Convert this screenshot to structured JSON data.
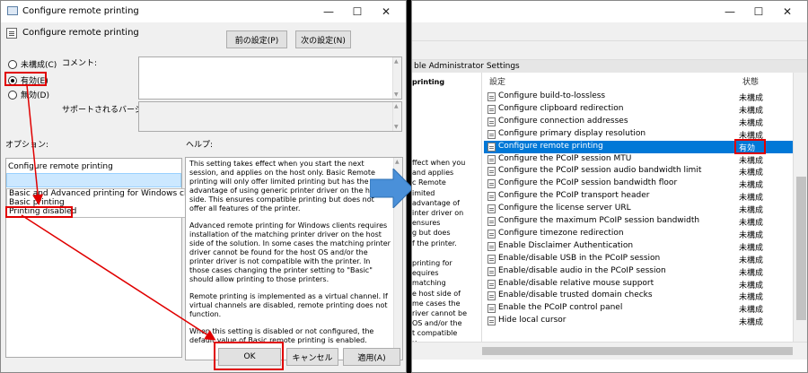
{
  "dialog": {
    "title": "Configure remote printing",
    "header_title": "Configure remote printing",
    "prev_button": "前の設定(P)",
    "next_button": "次の設定(N)",
    "radio_not_configured": "未構成(C)",
    "radio_enabled": "有効(E)",
    "radio_disabled": "無効(D)",
    "comment_label": "コメント:",
    "supported_label": "サポートされるバージョン:",
    "options_label": "オプション:",
    "help_label": "ヘルプ:",
    "combo_value": "Configure remote printing",
    "dropdown_options": [
      "Basic and Advanced printing for Windows clients",
      "Basic printing",
      "Printing disabled"
    ],
    "help_paragraphs": [
      "This setting takes effect when you start the next session, and applies on the host only. Basic Remote printing will only offer limited printing but has the advantage of using generic printer driver on the host side. This ensures compatible printing but does not offer all features of the printer.",
      "Advanced remote printing for Windows clients requires installation of the matching printer driver on the host side of the solution. In some cases the matching printer driver cannot be found for the host OS and/or the printer driver is not compatible with the printer. In those cases changing the printer setting to \"Basic\" should allow printing to those printers.",
      "Remote printing is implemented as a virtual channel. If virtual channels are disabled, remote printing does not function.",
      "When this setting is disabled or not configured, the default value of Basic remote printing is enabled."
    ],
    "ok_button": "OK",
    "cancel_button": "キャンセル",
    "apply_button": "適用(A)"
  },
  "mmc": {
    "panel_header": "ble Administrator Settings",
    "left_title": "printing",
    "left_fragments": [
      "ffect when you",
      "and applies",
      "c Remote",
      "imited",
      "advantage of",
      "inter driver on",
      "ensures",
      "g but does",
      "f the printer.",
      "",
      "printing for",
      "equires",
      "matching",
      "e host side of",
      "me cases the",
      "river cannot be",
      "OS and/or the",
      "t compatible",
      "those cases"
    ],
    "col_setting": "設定",
    "col_state": "状態",
    "rows": [
      {
        "name": "Configure build-to-lossless",
        "state": "未構成"
      },
      {
        "name": "Configure clipboard redirection",
        "state": "未構成"
      },
      {
        "name": "Configure connection addresses",
        "state": "未構成"
      },
      {
        "name": "Configure primary display resolution",
        "state": "未構成"
      },
      {
        "name": "Configure remote printing",
        "state": "有効"
      },
      {
        "name": "Configure the PCoIP session MTU",
        "state": "未構成"
      },
      {
        "name": "Configure the PCoIP session audio bandwidth limit",
        "state": "未構成"
      },
      {
        "name": "Configure the PCoIP session bandwidth floor",
        "state": "未構成"
      },
      {
        "name": "Configure the PCoIP transport header",
        "state": "未構成"
      },
      {
        "name": "Configure the license server URL",
        "state": "未構成"
      },
      {
        "name": "Configure the maximum PCoIP session bandwidth",
        "state": "未構成"
      },
      {
        "name": "Configure timezone redirection",
        "state": "未構成"
      },
      {
        "name": "Enable Disclaimer Authentication",
        "state": "未構成"
      },
      {
        "name": "Enable/disable USB in the PCoIP session",
        "state": "未構成"
      },
      {
        "name": "Enable/disable audio in the PCoIP session",
        "state": "未構成"
      },
      {
        "name": "Enable/disable relative mouse support",
        "state": "未構成"
      },
      {
        "name": "Enable/disable trusted domain checks",
        "state": "未構成"
      },
      {
        "name": "Enable the PCoIP control panel",
        "state": "未構成"
      },
      {
        "name": "Hide local cursor",
        "state": "未構成"
      }
    ]
  },
  "colors": {
    "highlight": "#e00000",
    "selection": "#0078d7",
    "arrow": "#4a90d9"
  }
}
